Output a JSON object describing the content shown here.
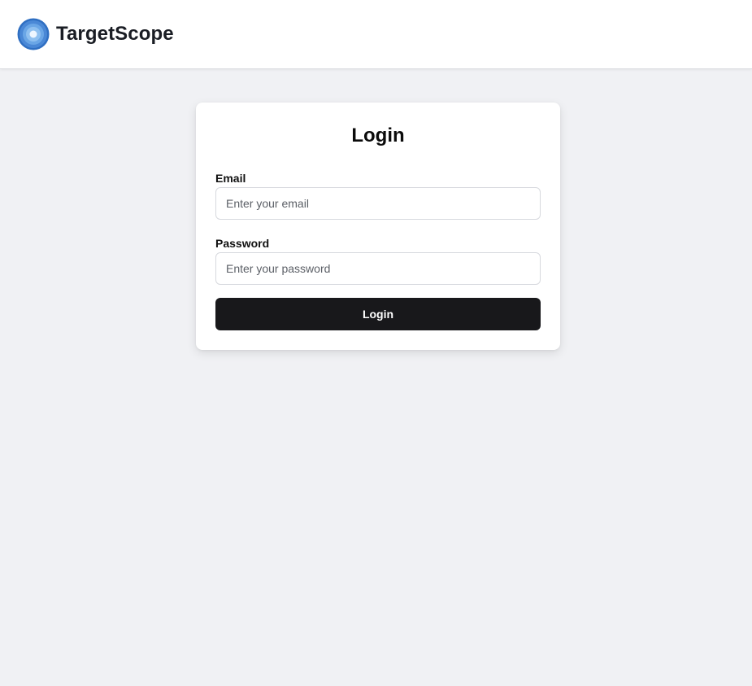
{
  "header": {
    "brand_name": "TargetScope",
    "logo_icon": "target-icon"
  },
  "login": {
    "title": "Login",
    "email_label": "Email",
    "email_value": "",
    "email_placeholder": "Enter your email",
    "password_label": "Password",
    "password_value": "",
    "password_placeholder": "Enter your password",
    "submit_label": "Login"
  },
  "colors": {
    "page_background": "#f0f1f4",
    "button_background": "#18181b",
    "logo_outer": "#2f6fc2",
    "logo_mid": "#5a9ae0",
    "logo_inner": "#a9d0f5"
  }
}
